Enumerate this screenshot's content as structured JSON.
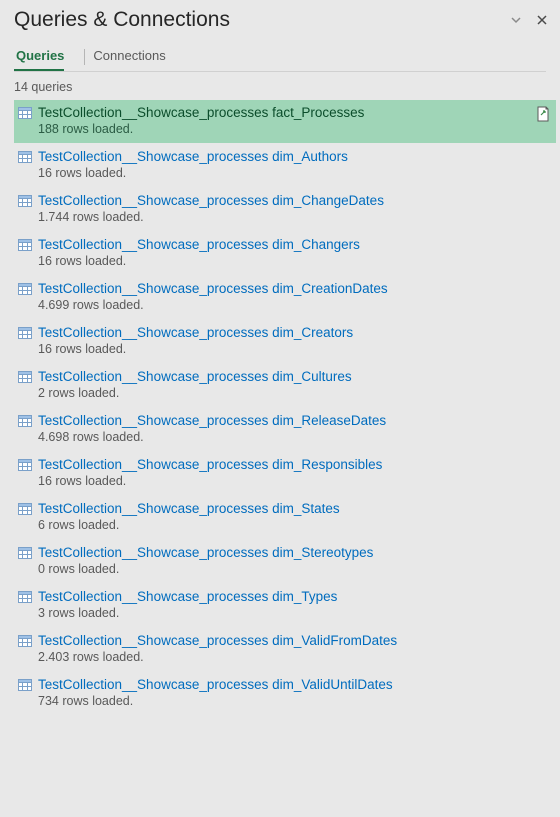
{
  "panel": {
    "title": "Queries & Connections"
  },
  "tabs": {
    "queries": "Queries",
    "connections": "Connections"
  },
  "summary": "14 queries",
  "queries": [
    {
      "name": "TestCollection__Showcase_processes fact_Processes",
      "status": "188 rows loaded.",
      "selected": true
    },
    {
      "name": "TestCollection__Showcase_processes dim_Authors",
      "status": "16 rows loaded."
    },
    {
      "name": "TestCollection__Showcase_processes dim_ChangeDates",
      "status": "1.744 rows loaded."
    },
    {
      "name": "TestCollection__Showcase_processes dim_Changers",
      "status": "16 rows loaded."
    },
    {
      "name": "TestCollection__Showcase_processes dim_CreationDates",
      "status": "4.699 rows loaded."
    },
    {
      "name": "TestCollection__Showcase_processes dim_Creators",
      "status": "16 rows loaded."
    },
    {
      "name": "TestCollection__Showcase_processes dim_Cultures",
      "status": "2 rows loaded."
    },
    {
      "name": "TestCollection__Showcase_processes dim_ReleaseDates",
      "status": "4.698 rows loaded."
    },
    {
      "name": "TestCollection__Showcase_processes dim_Responsibles",
      "status": "16 rows loaded."
    },
    {
      "name": "TestCollection__Showcase_processes dim_States",
      "status": "6 rows loaded."
    },
    {
      "name": "TestCollection__Showcase_processes dim_Stereotypes",
      "status": "0 rows loaded."
    },
    {
      "name": "TestCollection__Showcase_processes dim_Types",
      "status": "3 rows loaded."
    },
    {
      "name": "TestCollection__Showcase_processes dim_ValidFromDates",
      "status": "2.403 rows loaded."
    },
    {
      "name": "TestCollection__Showcase_processes dim_ValidUntilDates",
      "status": "734 rows loaded."
    }
  ]
}
